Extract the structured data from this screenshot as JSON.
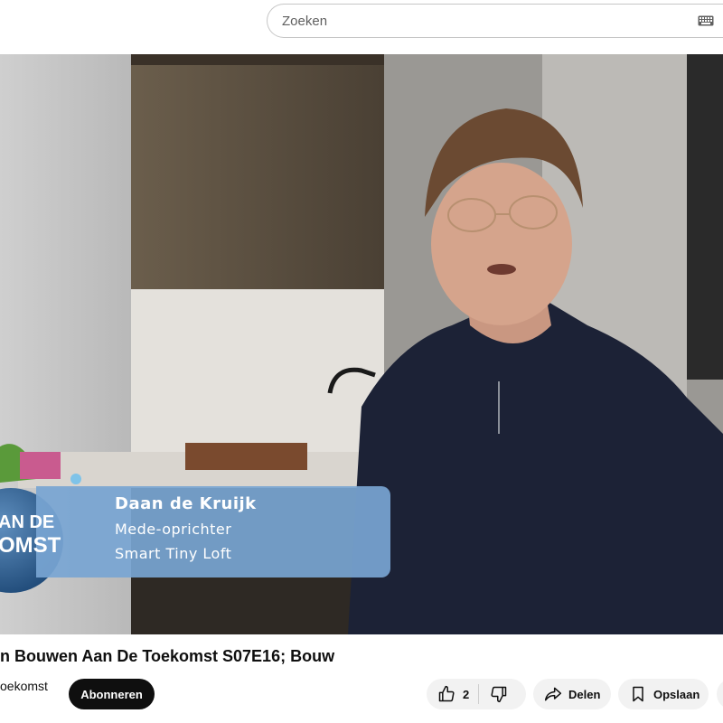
{
  "search": {
    "placeholder": "Zoeken"
  },
  "overlay": {
    "name": "Daan de Kruijk",
    "role": "Mede-oprichter",
    "company": "Smart Tiny Loft",
    "logo_line1": "AN DE",
    "logo_line2": "OMST"
  },
  "video": {
    "title": "n Bouwen Aan De Toekomst S07E16; Bouw"
  },
  "channel": {
    "name": "oekomst",
    "subscribe_label": "Abonneren"
  },
  "actions": {
    "like_count": "2",
    "share_label": "Delen",
    "save_label": "Opslaan"
  },
  "icons": [
    "keyboard-icon",
    "thumbs-up-icon",
    "thumbs-down-icon",
    "share-icon",
    "bookmark-icon"
  ]
}
